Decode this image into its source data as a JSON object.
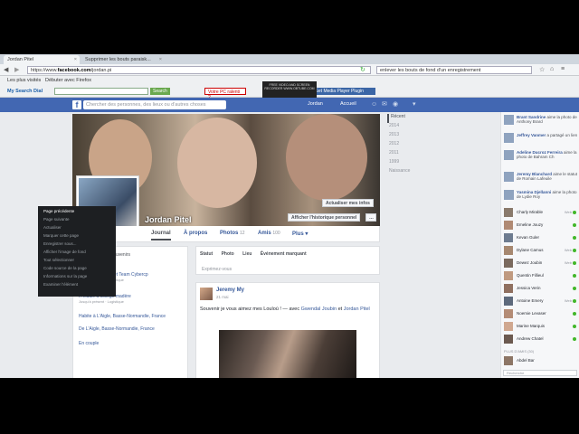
{
  "browser": {
    "tabs": [
      {
        "title": "Jordan Pitel",
        "active": true
      },
      {
        "title": "Supprimer les bouts paraisk...",
        "active": false
      }
    ],
    "url_prefix": "https://www.",
    "url_domain": "facebook.com",
    "url_path": "/jordan.pi",
    "search_value": "enlever les bouts de fond d'un enregistrement",
    "bookmarks": [
      "Les plus visités",
      "Débuter avec Firefox"
    ],
    "toolbar": {
      "brand": "My Search Dial",
      "search_button": "Search",
      "btn1": "Votre PC ralenti ?",
      "btn2": "Get Media Player Plugin"
    },
    "recorder_badge": "FREE VIDEO AND SCREEN RECORDER WWW.OBTUBE.COM"
  },
  "facebook": {
    "logo": "f",
    "search_placeholder": "Chercher des personnes, des lieux ou d'autres choses",
    "user": "Jordan",
    "home": "Accueil",
    "profile_name": "Jordan Pitel",
    "update_info_button": "Actualiser mes infos",
    "activity_log_button": "Afficher l'historique personnel",
    "nav": {
      "journal": "Journal",
      "about": "À propos",
      "photos": "Photos",
      "photos_count": "12",
      "friends": "Amis",
      "friends_count": "100",
      "more": "Plus"
    },
    "context_menu": [
      "Page précédente",
      "Page suivante",
      "Actualiser",
      "Marquer cette page",
      "Enregistrer sous...",
      "Afficher l'image de fond",
      "Tout sélectionner",
      "Code source de la page",
      "Informations sur la page",
      "Examiner l'élément"
    ],
    "intro": {
      "header": "...rtaires de vos souvenirs",
      "rows": [
        {
          "title": "...ollège Cybercp et Team Cybercp",
          "sub": "Jusqu'à présent · Logistique"
        },
        {
          "title": "A étudié à collège madère",
          "sub": "Jusqu'à présent · Logistique"
        },
        {
          "title": "Habite à L'Aigle, Basse-Normandie, France",
          "sub": ""
        },
        {
          "title": "De L'Aigle, Basse-Normandie, France",
          "sub": ""
        },
        {
          "title": "En couple",
          "sub": ""
        }
      ]
    },
    "composer": {
      "tabs": [
        "Statut",
        "Photo",
        "Lieu",
        "Événement marquant"
      ],
      "placeholder": "Exprimez-vous"
    },
    "post": {
      "author": "Jeremy My",
      "time": "21 mai",
      "text_before": "Souvenir je vous aimez mes Louloù ! ",
      "text_with": "— avec ",
      "tag1": "Gwendal Joubin",
      "tag_sep": " et ",
      "tag2": "Jordan Pitel"
    },
    "timeline_years": [
      "Récent",
      "2014",
      "2013",
      "2012",
      "2011",
      "1999",
      "Naissance"
    ],
    "ticker": [
      {
        "name": "Brant Sandrine",
        "action": "aime la photo de Anthony Brard"
      },
      {
        "name": "Jeffrey Vanmer",
        "action": "a partagé un lien"
      },
      {
        "name": "Adeline Ducroz Ferreira",
        "action": "aime la photo de Bahram Ch"
      },
      {
        "name": "Jeremy Blanchard",
        "action": "aime le statut de Romain Lafeuile"
      },
      {
        "name": "Yasmina Djellanni",
        "action": "aime la photo de Lydie Roy"
      }
    ],
    "friends": [
      {
        "name": "Charly Mirable",
        "status": "Web"
      },
      {
        "name": "Emeline Jouzy",
        "status": ""
      },
      {
        "name": "Kevan Guler",
        "status": ""
      },
      {
        "name": "Dylane Camus",
        "status": "Web"
      },
      {
        "name": "Dewez Joubin",
        "status": "Web"
      },
      {
        "name": "Quentin Fillieul",
        "status": ""
      },
      {
        "name": "Jessica Verin",
        "status": ""
      },
      {
        "name": "Antoine Emery",
        "status": "Web"
      },
      {
        "name": "Noemie Levaser",
        "status": ""
      },
      {
        "name": "Marine Marquis",
        "status": ""
      },
      {
        "name": "Andrew Chatel",
        "status": ""
      }
    ],
    "chat_more_header": "PLUS D'AMIS (30)",
    "chat_more_first": "Abdel Bar",
    "chat_search": "Recherche"
  }
}
